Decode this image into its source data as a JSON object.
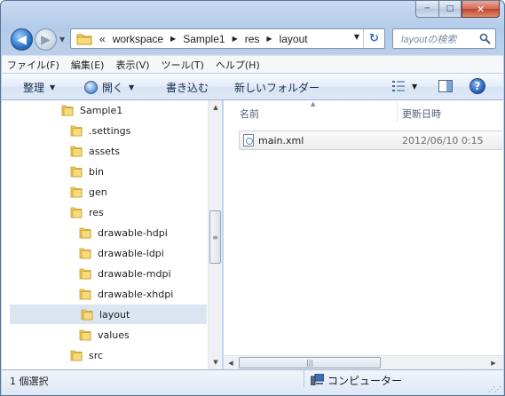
{
  "window": {
    "caption_min": "─",
    "caption_max": "□",
    "caption_close": "✕"
  },
  "nav": {
    "back_glyph": "◀",
    "forward_glyph": "▶",
    "recent_glyph": "▼"
  },
  "address": {
    "overflow": "«",
    "crumbs": [
      "workspace",
      "Sample1",
      "res",
      "layout"
    ],
    "separator": "▶",
    "dropdown": "▼",
    "refresh_glyph": "↻"
  },
  "search": {
    "placeholder": "layoutの検索"
  },
  "menubar": {
    "items": [
      "ファイル(F)",
      "編集(E)",
      "表示(V)",
      "ツール(T)",
      "ヘルプ(H)"
    ]
  },
  "commandbar": {
    "organize": "整理",
    "open": "開く",
    "burn": "書き込む",
    "new_folder": "新しいフォルダー",
    "dropdown": "▼",
    "help": "?"
  },
  "tree": {
    "items": [
      {
        "label": "Sample1",
        "level": 0
      },
      {
        "label": ".settings",
        "level": 1
      },
      {
        "label": "assets",
        "level": 1
      },
      {
        "label": "bin",
        "level": 1
      },
      {
        "label": "gen",
        "level": 1
      },
      {
        "label": "res",
        "level": 1
      },
      {
        "label": "drawable-hdpi",
        "level": 2
      },
      {
        "label": "drawable-ldpi",
        "level": 2
      },
      {
        "label": "drawable-mdpi",
        "level": 2
      },
      {
        "label": "drawable-xhdpi",
        "level": 2
      },
      {
        "label": "layout",
        "level": 2,
        "selected": true
      },
      {
        "label": "values",
        "level": 2
      },
      {
        "label": "src",
        "level": 1
      }
    ]
  },
  "scroll": {
    "up": "▲",
    "down": "▼",
    "left": "◀",
    "right": "▶",
    "grip_v": "≡",
    "grip_h": "|||"
  },
  "list": {
    "columns": {
      "name": "名前",
      "modified": "更新日時"
    },
    "sort_glyph": "▲",
    "files": [
      {
        "name": "main.xml",
        "modified": "2012/06/10 0:15"
      }
    ]
  },
  "status": {
    "selection": "1 個選択",
    "location": "コンピューター",
    "grip": "⋰⋰"
  },
  "colors": {
    "folder": "#f2cd5c",
    "accent": "#2a72c8",
    "selection": "#dbe5f2"
  }
}
